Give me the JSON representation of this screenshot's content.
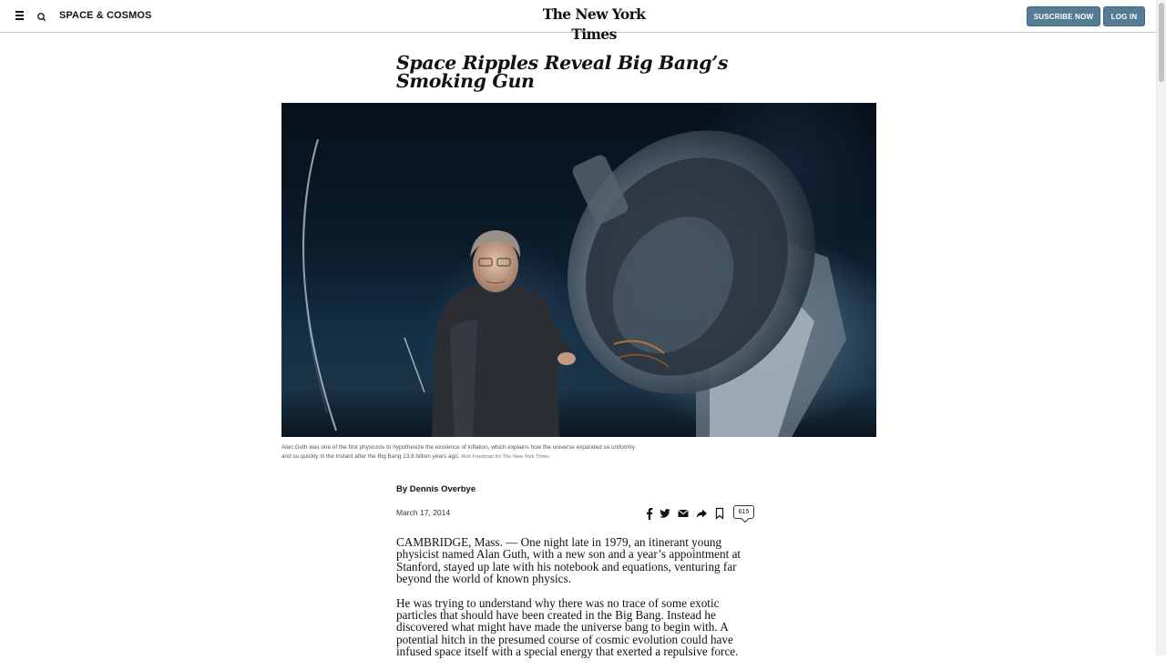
{
  "header": {
    "section_name": "SPACE & COSMOS",
    "logo": "The New York Times",
    "subscribe_label": "SUSCRIBE NOW",
    "login_label": "LOG IN"
  },
  "article": {
    "headline": "Space Ripples Reveal Big Bang’s Smoking Gun",
    "caption": "Alan Guth was one of the first physicists to hypothesize the existence of inflation, which explains how the universe expanded so uniformly and so quickly in the instant after the Big Bang 13.8 billion years ago.",
    "credit": "Rick Friedman for The New York Times",
    "byline": "By Dennis Overbye",
    "date": "March 17, 2014",
    "comment_count": "615",
    "paragraphs": [
      "CAMBRIDGE, Mass. — One night late in 1979, an itinerant young physicist named Alan Guth, with a new son and a year’s appointment at Stanford, stayed up late with his notebook and equations, venturing far beyond the world of known physics.",
      "He was trying to understand why there was no trace of some exotic particles that should have been created in the Big Bang. Instead he discovered what might have made the universe bang to begin with. A potential hitch in the presumed course of cosmic evolution could have infused space itself with a special energy that exerted a repulsive force."
    ]
  },
  "share_tools": [
    "facebook-icon",
    "twitter-icon",
    "email-icon",
    "share-icon",
    "bookmark-icon"
  ]
}
